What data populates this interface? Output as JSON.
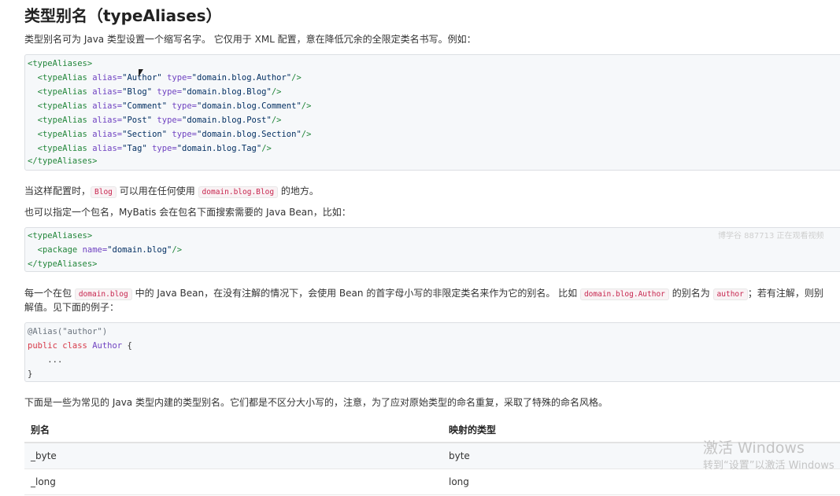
{
  "heading": "类型别名（typeAliases）",
  "intro": "类型别名可为 Java 类型设置一个缩写名字。 它仅用于 XML 配置，意在降低冗余的全限定类名书写。例如：",
  "code1": {
    "open": "<typeAliases>",
    "items": [
      {
        "alias": "Author",
        "type": "domain.blog.Author"
      },
      {
        "alias": "Blog",
        "type": "domain.blog.Blog"
      },
      {
        "alias": "Comment",
        "type": "domain.blog.Comment"
      },
      {
        "alias": "Post",
        "type": "domain.blog.Post"
      },
      {
        "alias": "Section",
        "type": "domain.blog.Section"
      },
      {
        "alias": "Tag",
        "type": "domain.blog.Tag"
      }
    ],
    "close": "</typeAliases>"
  },
  "para2": {
    "before": "当这样配置时，",
    "code_a": "Blog",
    "middle": " 可以用在任何使用 ",
    "code_b": "domain.blog.Blog",
    "after": " 的地方。"
  },
  "para3": "也可以指定一个包名，MyBatis 会在包名下面搜索需要的 Java Bean，比如：",
  "code2": {
    "open": "<typeAliases>",
    "package_name": "domain.blog",
    "close": "</typeAliases>"
  },
  "watermark_viewers": "博学谷 887713 正在观看视频",
  "para4": {
    "t1": "每一个在包 ",
    "c1": "domain.blog",
    "t2": " 中的 Java Bean，在没有注解的情况下，会使用 Bean 的首字母小写的非限定类名来作为它的别名。 比如 ",
    "c2": "domain.blog.Author",
    "t3": " 的别名为 ",
    "c3": "author",
    "t4": "；若有注解，则别",
    "line2": "解值。见下面的例子："
  },
  "code3": {
    "line1": "@Alias(\"author\")",
    "kw1": "public",
    "kw2": "class",
    "classname": "Author",
    "brace_open": "{",
    "body": "...",
    "brace_close": "}"
  },
  "para5": "下面是一些为常见的 Java 类型内建的类型别名。它们都是不区分大小写的，注意，为了应对原始类型的命名重复，采取了特殊的命名风格。",
  "table": {
    "headers": [
      "别名",
      "映射的类型"
    ],
    "rows": [
      [
        "_byte",
        "byte"
      ],
      [
        "_long",
        "long"
      ]
    ]
  },
  "activation": {
    "line1": "激活 Windows",
    "line2": "转到“设置”以激活 Windows"
  }
}
